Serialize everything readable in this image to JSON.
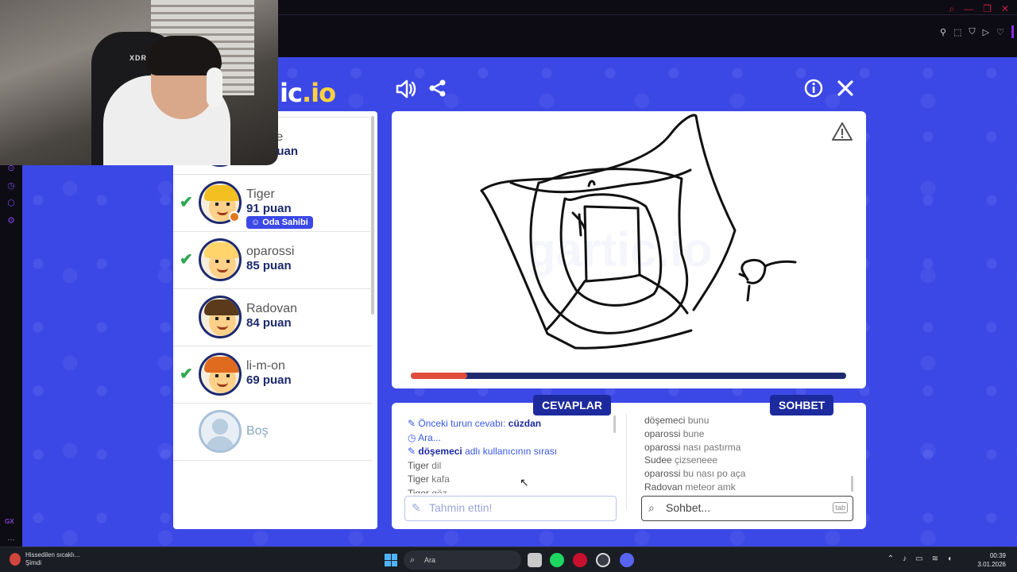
{
  "browser": {
    "window_controls": [
      "search-icon",
      "minimize-icon",
      "restore-icon",
      "close-icon"
    ],
    "extension_icons": [
      "pin-icon",
      "snapshot-icon",
      "shield-icon",
      "play-icon",
      "heart-icon"
    ]
  },
  "webcam": {
    "chair_brand": "XDRIVE"
  },
  "game": {
    "logo_left": "ic",
    "logo_right": ".io",
    "players": [
      {
        "name": "döşemeci",
        "score": "puan",
        "guessed": false,
        "hidden": true
      },
      {
        "name": "Sudee",
        "score": "101 puan",
        "guessed": true,
        "hair": "#2a74c8",
        "dot": "#c0c0c0"
      },
      {
        "name": "Tiger",
        "score": "91 puan",
        "guessed": true,
        "hair": "#f4c021",
        "dot": "#e0781e",
        "badge": "Oda Sahibi"
      },
      {
        "name": "oparossi",
        "score": "85 puan",
        "guessed": true,
        "hair": "#ffd46a"
      },
      {
        "name": "Radovan",
        "score": "84 puan",
        "guessed": false,
        "hair": "#5a3a1a"
      },
      {
        "name": "li-m-on",
        "score": "69 puan",
        "guessed": true,
        "hair": "#e06b1f"
      },
      {
        "name": "Boş",
        "empty": true
      }
    ],
    "drawing_progress": 0.13,
    "tabs": {
      "answers": "CEVAPLAR",
      "chat": "SOHBET"
    },
    "answers": {
      "prev_label": "Önceki turun cevabı: ",
      "prev_word": "cüzdan",
      "waiting": "Ara...",
      "turn_user": "döşemeci",
      "turn_suffix": " adlı kullanıcının sırası",
      "lines": [
        {
          "user": "Tiger",
          "text": " dil"
        },
        {
          "user": "Tiger",
          "text": " kafa"
        },
        {
          "user": "Tiger",
          "text": " göz"
        }
      ],
      "placeholder": "Tahmin ettin!"
    },
    "chat": {
      "lines": [
        {
          "user": "döşemeci",
          "text": " bunu"
        },
        {
          "user": "oparossi",
          "text": " bune"
        },
        {
          "user": "oparossi",
          "text": " nası pastırma"
        },
        {
          "user": "Sudee",
          "text": " çizseneee"
        },
        {
          "user": "oparossi",
          "text": " bu nası po aça"
        },
        {
          "user": "Radovan",
          "text": " meteor amk"
        }
      ],
      "placeholder": "Sohbet...",
      "tab_key": "tab"
    }
  },
  "taskbar": {
    "weather_line1": "Hissedilen sıcaklı...",
    "weather_line2": "Şimdi",
    "search": "Ara",
    "time": "00:39",
    "date": "3.01.2026"
  }
}
